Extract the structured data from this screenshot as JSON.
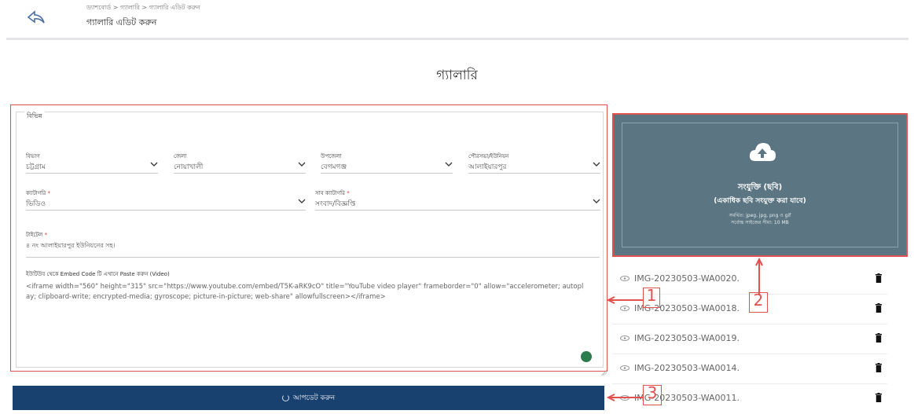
{
  "header": {
    "back_icon": "back-arrow-icon",
    "breadcrumb": "ড্যাশবোর্ড > গ্যালারি > গ্যালারি এডিট করুন",
    "subtitle": "গ্যালারি এডিট করুন"
  },
  "page": {
    "heading": "গ্যালারি"
  },
  "form": {
    "legend": "বিভিন্ন",
    "division": {
      "label": "বিভাগ",
      "value": "চট্টগ্রাম"
    },
    "district": {
      "label": "জেলা",
      "value": "নোয়াখালী"
    },
    "upazila": {
      "label": "উপজেলা",
      "value": "বেগমগঞ্জ"
    },
    "union": {
      "label": "পৌরসভা/ইউনিয়ন",
      "value": "আলাইয়ারপুর"
    },
    "category": {
      "label": "ক্যাটাগরি",
      "required": "*",
      "value": "ভিডিও"
    },
    "subcategory": {
      "label": "সাব ক্যাটাগরি",
      "required": "*",
      "value": "সংবাদ/বিজ্ঞপ্তি"
    },
    "title": {
      "label": "টাইটেল",
      "required": "*",
      "value": "৪ নং আলাইয়ারপুর ইউনিয়নের সহ।"
    },
    "embed": {
      "label": "ইউটিউব থেকে Embed Code টি এখানে Paste করুন (Video)",
      "value": "<iframe width=\"560\" height=\"315\" src=\"https://www.youtube.com/embed/T5K-aRK9cO\" title=\"YouTube video player\" frameborder=\"0\" allow=\"accelerometer; autoplay; clipboard-write; encrypted-media; gyroscope; picture-in-picture; web-share\" allowfullscreen></iframe>"
    }
  },
  "save_button": {
    "label": "আপডেট করুন"
  },
  "upload": {
    "icon": "cloud-upload-icon",
    "title": "সংযুক্তি (ছবি)",
    "subtitle": "(একাধিক ছবি সংযুক্ত করা যাবে)",
    "note1": "সমর্থিত: jpeg, jpg, png ও gif",
    "note2": "সর্বোচ্চ সাইজের সীমা: 10 MB"
  },
  "files": [
    {
      "name": "IMG-20230503-WA0020."
    },
    {
      "name": "IMG-20230503-WA0018."
    },
    {
      "name": "IMG-20230503-WA0019."
    },
    {
      "name": "IMG-20230503-WA0014."
    },
    {
      "name": "IMG-20230503-WA0011."
    }
  ],
  "annotations": {
    "one": "1",
    "two": "2",
    "three": "3"
  },
  "colors": {
    "primary": "#184170",
    "upload_bg": "#5b7582",
    "highlight": "#e0524f"
  }
}
